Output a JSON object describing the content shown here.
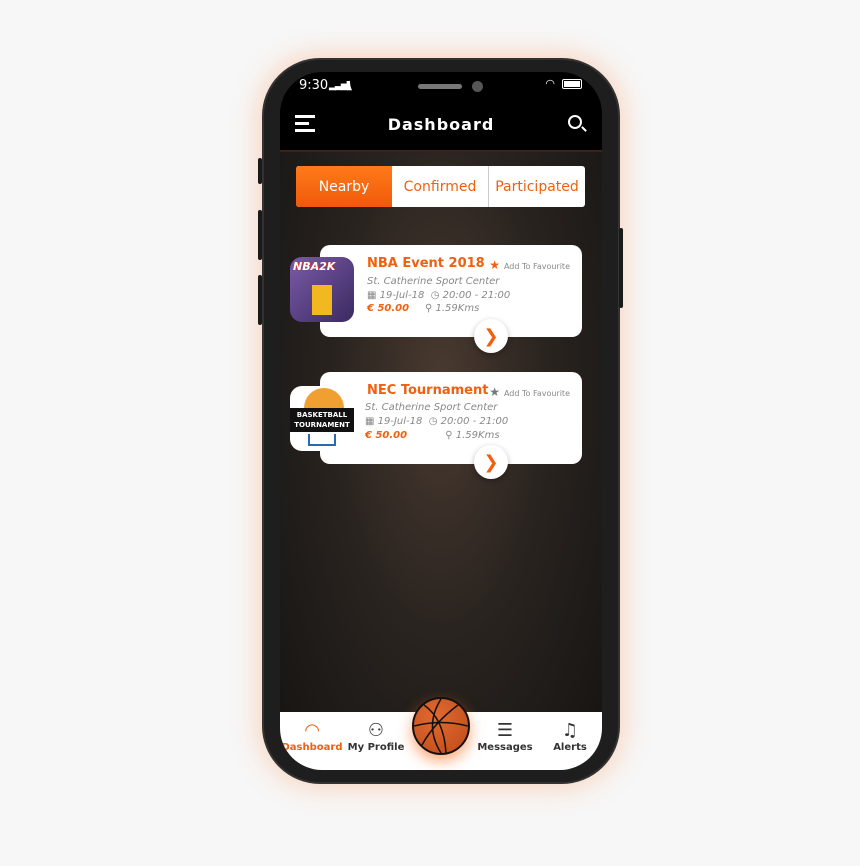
{
  "status": {
    "time": "9:30"
  },
  "header": {
    "title": "Dashboard",
    "menu_icon": "hamburger-icon",
    "search_icon": "search-icon"
  },
  "tabs": [
    {
      "label": "Nearby",
      "active": true
    },
    {
      "label": "Confirmed"
    },
    {
      "label": "Participated"
    }
  ],
  "events": [
    {
      "title": "NBA Event 2018",
      "favourite": "Add To Favourite",
      "fav_color": "#f0600f",
      "venue": "St. Catherine Sport Center",
      "date": "19-Jul-18",
      "time": "20:00 - 21:00",
      "price": "€  50.00",
      "distance": "1.59Kms",
      "thumb_text": "NBA2K"
    },
    {
      "title": "NEC Tournament",
      "favourite": "Add To Favourite",
      "fav_color": "#777777",
      "venue": "St. Catherine Sport Center",
      "date": "19-Jul-18",
      "time": "20:00 - 21:00",
      "price": "€  50.00",
      "distance": "1.59Kms",
      "thumb_text": "BASKETBALL TOURNAMENT"
    }
  ],
  "nav": [
    {
      "label": "Dashboard",
      "icon": "speedometer-icon",
      "active": true
    },
    {
      "label": "My Profile",
      "icon": "user-icon"
    },
    {
      "label": "Messages",
      "icon": "chat-icon"
    },
    {
      "label": "Alerts",
      "icon": "bell-icon"
    }
  ],
  "colors": {
    "accent": "#f0600f"
  }
}
